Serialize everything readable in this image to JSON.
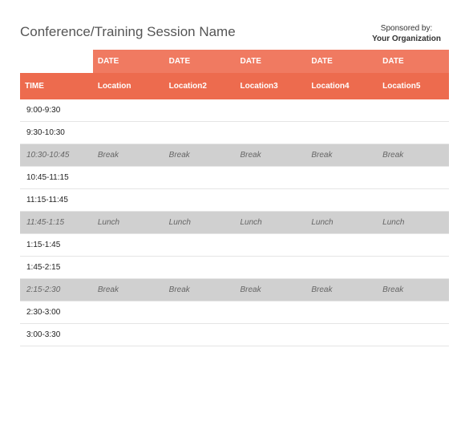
{
  "header": {
    "title": "Conference/Training Session Name",
    "sponsor_label": "Sponsored by:",
    "sponsor_org": "Your Organization"
  },
  "table": {
    "date_headers": [
      "",
      "DATE",
      "DATE",
      "DATE",
      "DATE",
      "DATE"
    ],
    "loc_headers": [
      "TIME",
      "Location",
      "Location2",
      "Location3",
      "Location4",
      "Location5"
    ],
    "rows": [
      {
        "time": "9:00-9:30",
        "cells": [
          "",
          "",
          "",
          "",
          ""
        ],
        "special": false
      },
      {
        "time": "9:30-10:30",
        "cells": [
          "",
          "",
          "",
          "",
          ""
        ],
        "special": false
      },
      {
        "time": "10:30-10:45",
        "cells": [
          "Break",
          "Break",
          "Break",
          "Break",
          "Break"
        ],
        "special": true
      },
      {
        "time": "10:45-11:15",
        "cells": [
          "",
          "",
          "",
          "",
          ""
        ],
        "special": false
      },
      {
        "time": "11:15-11:45",
        "cells": [
          "",
          "",
          "",
          "",
          ""
        ],
        "special": false
      },
      {
        "time": "11:45-1:15",
        "cells": [
          "Lunch",
          "Lunch",
          "Lunch",
          "Lunch",
          "Lunch"
        ],
        "special": true
      },
      {
        "time": "1:15-1:45",
        "cells": [
          "",
          "",
          "",
          "",
          ""
        ],
        "special": false
      },
      {
        "time": "1:45-2:15",
        "cells": [
          "",
          "",
          "",
          "",
          ""
        ],
        "special": false
      },
      {
        "time": "2:15-2:30",
        "cells": [
          "Break",
          "Break",
          "Break",
          "Break",
          "Break"
        ],
        "special": true
      },
      {
        "time": "2:30-3:00",
        "cells": [
          "",
          "",
          "",
          "",
          ""
        ],
        "special": false
      },
      {
        "time": "3:00-3:30",
        "cells": [
          "",
          "",
          "",
          "",
          ""
        ],
        "special": false
      }
    ]
  }
}
